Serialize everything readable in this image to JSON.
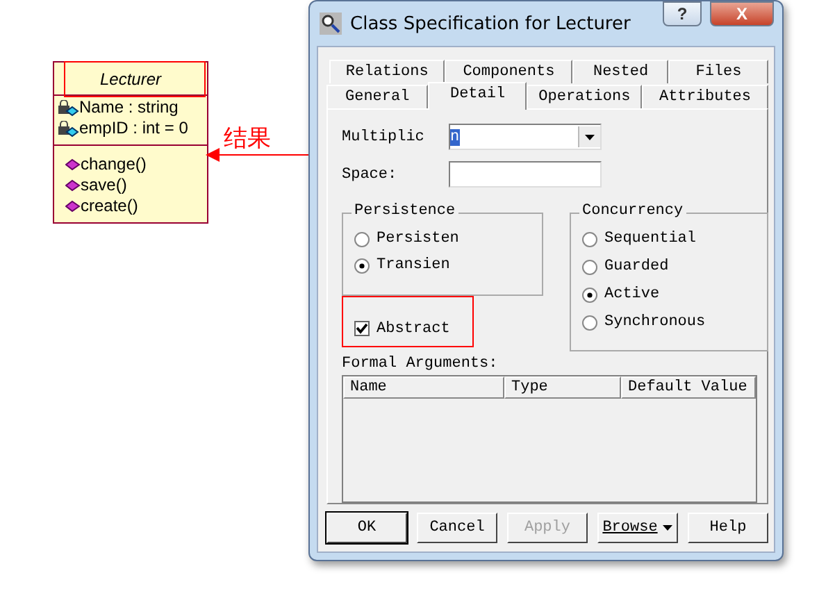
{
  "class_box": {
    "name": "Lecturer",
    "attributes": [
      {
        "text": "Name : string"
      },
      {
        "text": "empID : int = 0"
      }
    ],
    "operations": [
      {
        "text": "change()"
      },
      {
        "text": "save()"
      },
      {
        "text": "create()"
      }
    ]
  },
  "annotation": {
    "label": "结果"
  },
  "dialog": {
    "title": "Class Specification for Lecturer",
    "title_buttons": [
      {
        "label": "?",
        "kind": "help"
      },
      {
        "label": "X",
        "kind": "close"
      }
    ],
    "tab_rows": [
      [
        {
          "label": "Relations",
          "selected": false
        },
        {
          "label": "Components",
          "selected": false
        },
        {
          "label": "Nested",
          "selected": false
        },
        {
          "label": "Files",
          "selected": false
        }
      ],
      [
        {
          "label": "General",
          "selected": false
        },
        {
          "label": "Detail",
          "selected": true
        },
        {
          "label": "Operations",
          "selected": false
        },
        {
          "label": "Attributes",
          "selected": false
        }
      ]
    ],
    "fields": [
      {
        "label": "Multiplic",
        "value": "n",
        "kind": "dropdown"
      },
      {
        "label": "Space:",
        "kind": "text"
      }
    ],
    "persistence": {
      "title": "Persistence",
      "options": [
        {
          "label": "Persisten",
          "selected": false
        },
        {
          "label": "Transien",
          "selected": true
        }
      ]
    },
    "concurrency": {
      "title": "Concurrency",
      "options": [
        {
          "label": "Sequential",
          "selected": false
        },
        {
          "label": "Guarded",
          "selected": false
        },
        {
          "label": "Active",
          "selected": true
        },
        {
          "label": "Synchronous",
          "selected": false
        }
      ]
    },
    "abstract": {
      "label": "Abstract",
      "checked": true
    },
    "formal_arguments": {
      "label": "Formal Arguments:",
      "columns": [
        "Name",
        "Type",
        "Default Value"
      ]
    },
    "buttons": [
      {
        "label": "OK",
        "disabled": false,
        "default": true,
        "menu": false
      },
      {
        "label": "Cancel",
        "disabled": false,
        "default": false,
        "menu": false
      },
      {
        "label": "Apply",
        "disabled": true,
        "default": false,
        "menu": false
      },
      {
        "label": "Browse",
        "disabled": false,
        "default": false,
        "menu": true
      },
      {
        "label": "Help",
        "disabled": false,
        "default": false,
        "menu": false
      }
    ]
  }
}
